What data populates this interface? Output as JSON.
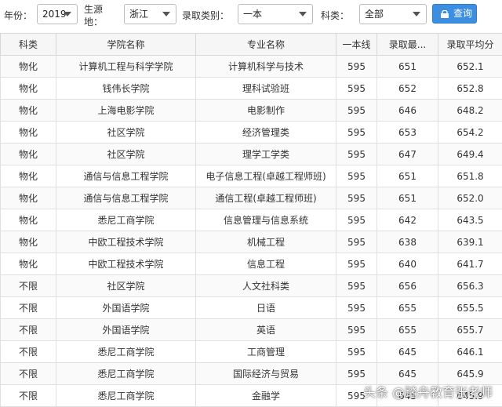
{
  "filters": {
    "year_label": "年份：",
    "year_value": "2019",
    "origin_label_1": "生源",
    "origin_label_2": "地：",
    "origin_value": "浙江",
    "category_label": "录取类别：",
    "category_value": "一本",
    "subject_label": "科类：",
    "subject_value": "全部",
    "query_label": "查询"
  },
  "table": {
    "headers": [
      "科类",
      "学院名称",
      "专业名称",
      "一本线",
      "录取最...",
      "录取平均分"
    ],
    "rows": [
      [
        "物化",
        "计算机工程与科学学院",
        "计算机科学与技术",
        "595",
        "651",
        "652.1"
      ],
      [
        "物化",
        "钱伟长学院",
        "理科试验班",
        "595",
        "652",
        "652.8"
      ],
      [
        "物化",
        "上海电影学院",
        "电影制作",
        "595",
        "646",
        "648.2"
      ],
      [
        "物化",
        "社区学院",
        "经济管理类",
        "595",
        "653",
        "654.2"
      ],
      [
        "物化",
        "社区学院",
        "理学工学类",
        "595",
        "647",
        "649.4"
      ],
      [
        "物化",
        "通信与信息工程学院",
        "电子信息工程(卓越工程师班)",
        "595",
        "651",
        "651.8"
      ],
      [
        "物化",
        "通信与信息工程学院",
        "通信工程(卓越工程师班)",
        "595",
        "651",
        "652.0"
      ],
      [
        "物化",
        "悉尼工商学院",
        "信息管理与信息系统",
        "595",
        "642",
        "643.5"
      ],
      [
        "物化",
        "中欧工程技术学院",
        "机械工程",
        "595",
        "638",
        "639.1"
      ],
      [
        "物化",
        "中欧工程技术学院",
        "信息工程",
        "595",
        "640",
        "641.7"
      ],
      [
        "不限",
        "社区学院",
        "人文社科类",
        "595",
        "656",
        "656.3"
      ],
      [
        "不限",
        "外国语学院",
        "日语",
        "595",
        "655",
        "655.5"
      ],
      [
        "不限",
        "外国语学院",
        "英语",
        "595",
        "655",
        "655.7"
      ],
      [
        "不限",
        "悉尼工商学院",
        "工商管理",
        "595",
        "645",
        "646.1"
      ],
      [
        "不限",
        "悉尼工商学院",
        "国际经济与贸易",
        "595",
        "645",
        "645.9"
      ],
      [
        "不限",
        "悉尼工商学院",
        "金融学",
        "595",
        "645",
        "645.9"
      ]
    ]
  },
  "watermark": "头条 @踏舟教育张老师",
  "colors": {
    "accent": "#3b8ee0",
    "border": "#d6d6d6"
  },
  "icons": {
    "query_icon": "lock-icon"
  }
}
